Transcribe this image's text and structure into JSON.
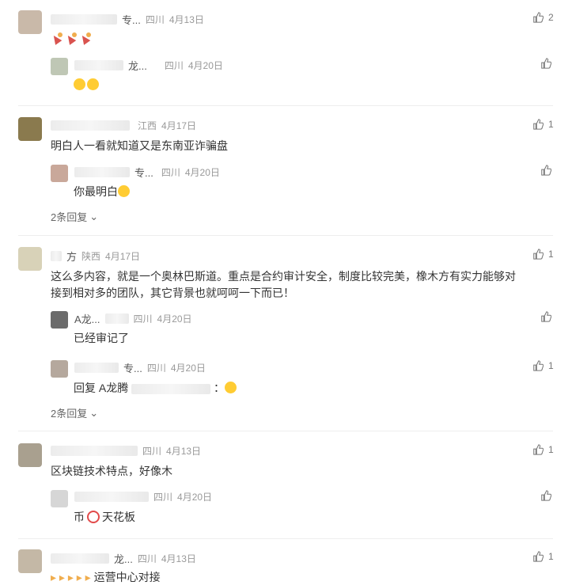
{
  "comments": [
    {
      "name_fragment": "专...",
      "location": "四川",
      "date": "4月13日",
      "likes": "2",
      "text_emojis": [
        "party-popper",
        "party-popper",
        "party-popper"
      ],
      "replies": [
        {
          "name_fragment": "龙...",
          "location": "四川",
          "date": "4月20日",
          "likes": "",
          "text": "",
          "text_emojis": [
            "laughing-face",
            "laughing-face"
          ]
        }
      ],
      "more_replies": ""
    },
    {
      "name_fragment": "...",
      "location": "江西",
      "date": "4月17日",
      "likes": "1",
      "text": "明白人一看就知道又是东南亚诈骗盘",
      "replies": [
        {
          "name_fragment": "专...",
          "location": "四川",
          "date": "4月20日",
          "likes": "",
          "text": "你最明白",
          "text_emojis": [
            "laughing-tears"
          ]
        }
      ],
      "more_replies": "2条回复"
    },
    {
      "name_fragment": "方",
      "location": "陕西",
      "date": "4月17日",
      "likes": "1",
      "text_line1": "这么多内容，就是一个奥林巴斯道。重点是合约审计安全，制度比较完美，橡木方有实力能够对",
      "text_line2": "接到相对多的团队，其它背景也就呵呵一下而已！",
      "replies": [
        {
          "name_fragment": "A龙...",
          "location": "四川",
          "date": "4月20日",
          "likes": "",
          "text": "已经审记了"
        },
        {
          "name_fragment": "专...",
          "location": "四川",
          "date": "4月20日",
          "likes": "1",
          "text": "回复 A龙腾",
          "text_suffix": "：",
          "text_emojis": [
            "smile"
          ]
        }
      ],
      "more_replies": "2条回复"
    },
    {
      "name_fragment": "...",
      "location": "四川",
      "date": "4月13日",
      "likes": "1",
      "text": "区块链技术特点，好像木",
      "replies": [
        {
          "name_fragment": "...",
          "location": "四川",
          "date": "4月20日",
          "likes": "",
          "text_before": "币",
          "text_after": "天花板"
        }
      ],
      "more_replies": ""
    },
    {
      "name_fragment": "龙...",
      "location": "四川",
      "date": "4月13日",
      "likes": "1",
      "text": "运营中心对接"
    }
  ],
  "colors": {
    "meta": "#999999",
    "text": "#333333",
    "emoji": "#ffcc33",
    "ring": "#e24a4a"
  },
  "icons": {
    "like": "thumbs-up-icon",
    "expand": "chevron-down-icon"
  }
}
